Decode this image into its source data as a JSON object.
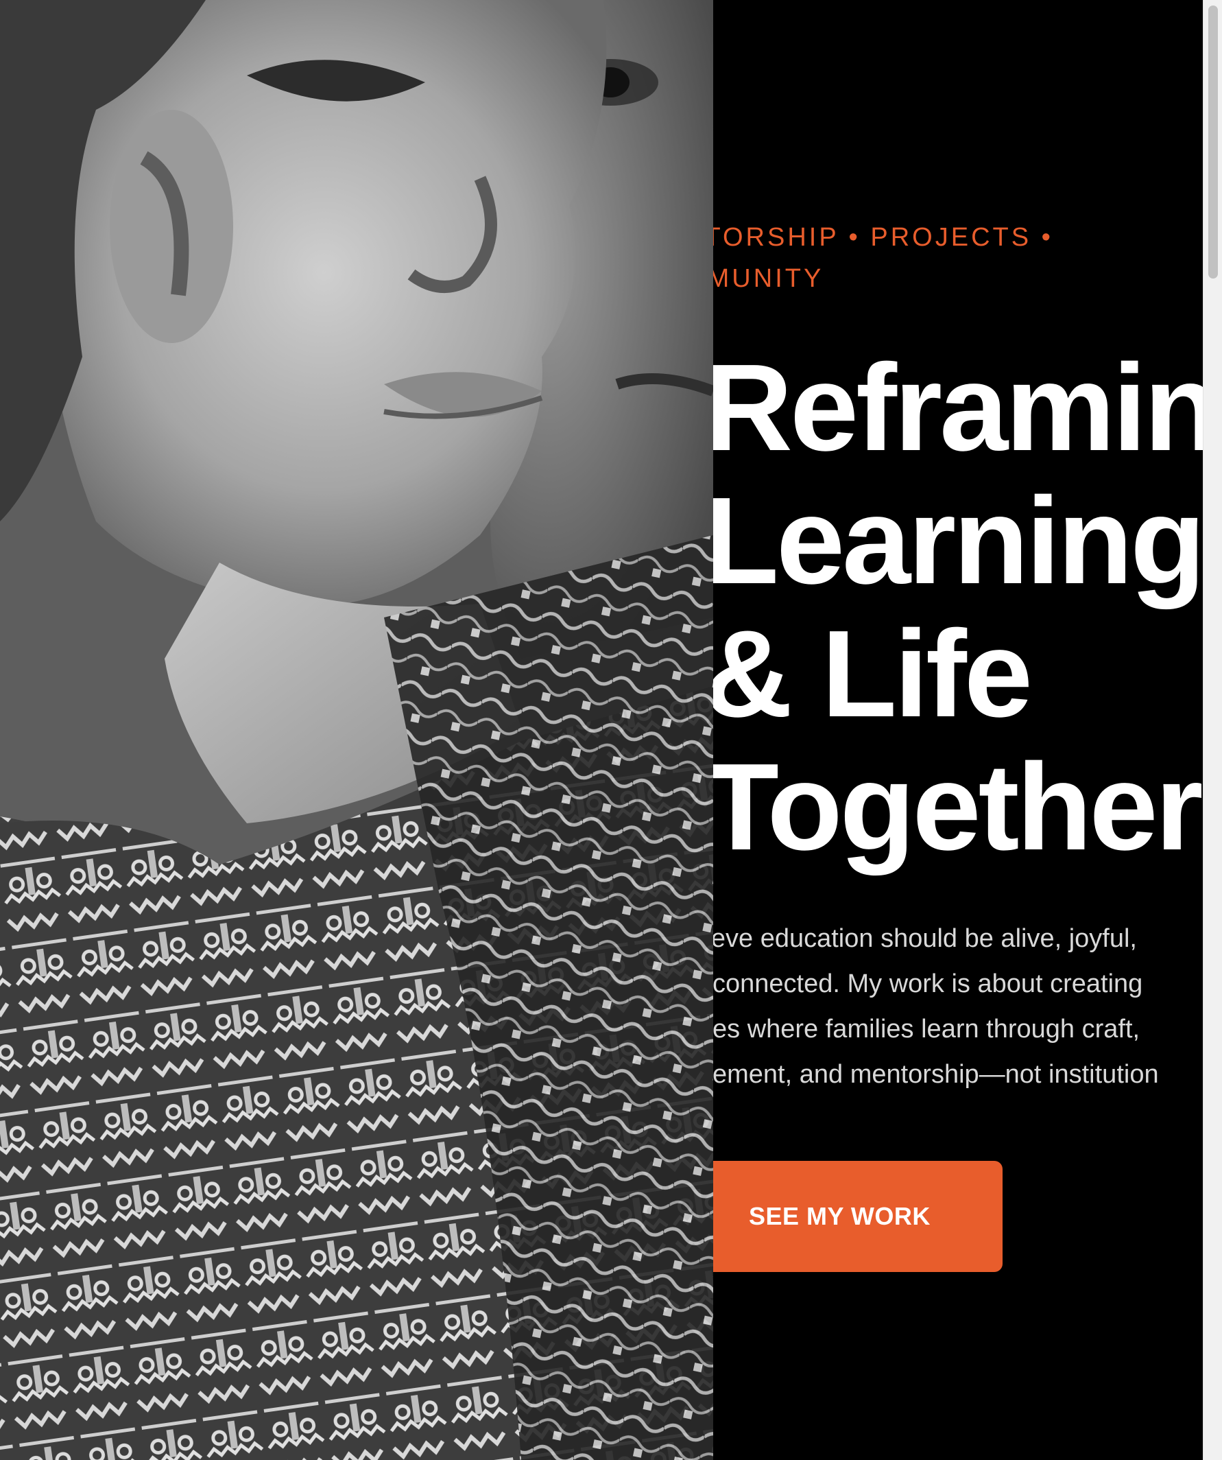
{
  "hero": {
    "photo": {
      "icon": "portrait-photo",
      "description_visible": false
    },
    "eyebrow": {
      "items": [
        "MENTORSHIP",
        "PROJECTS",
        "COMMUNITY"
      ],
      "separator": "•",
      "line_1": "NTORSHIP • PROJECTS •",
      "line_2": "MMUNITY"
    },
    "headline": {
      "line_1": "Reframing",
      "line_2": "Learning",
      "line_3": "& Life",
      "line_4": "Together"
    },
    "intro": {
      "line_1": "lieve education should be alive, joyful,",
      "line_2": "l connected. My work is about creating",
      "line_3": "ces where families learn through craft,",
      "line_4": "vement, and mentorship—not institution"
    },
    "cta": {
      "label": "SEE MY WORK"
    }
  },
  "colors": {
    "background": "#000000",
    "accent": "#e85d2c",
    "headline": "#ffffff",
    "body_text": "#d9d9d9"
  },
  "scrollbar": {
    "position_fraction": 0.0
  }
}
